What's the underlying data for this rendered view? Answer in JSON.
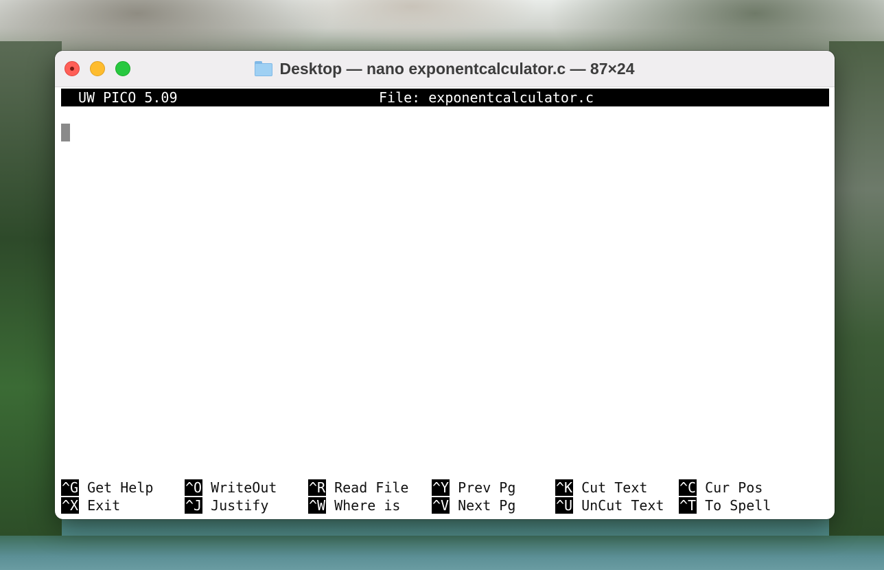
{
  "window": {
    "title": "Desktop — nano exponentcalculator.c — 87×24",
    "folder_icon": "folder-icon"
  },
  "editor": {
    "app_version": "UW PICO 5.09",
    "file_label": "File: exponentcalculator.c"
  },
  "shortcuts": {
    "row1": [
      {
        "key": "^G",
        "label": "Get Help"
      },
      {
        "key": "^O",
        "label": "WriteOut"
      },
      {
        "key": "^R",
        "label": "Read File"
      },
      {
        "key": "^Y",
        "label": "Prev Pg"
      },
      {
        "key": "^K",
        "label": "Cut Text"
      },
      {
        "key": "^C",
        "label": "Cur Pos"
      }
    ],
    "row2": [
      {
        "key": "^X",
        "label": "Exit"
      },
      {
        "key": "^J",
        "label": "Justify"
      },
      {
        "key": "^W",
        "label": "Where is"
      },
      {
        "key": "^V",
        "label": "Next Pg"
      },
      {
        "key": "^U",
        "label": "UnCut Text"
      },
      {
        "key": "^T",
        "label": "To Spell"
      }
    ]
  },
  "colors": {
    "close": "#ff5f57",
    "minimize": "#febc2e",
    "maximize": "#28c840",
    "folder": "#9fd0f3"
  }
}
